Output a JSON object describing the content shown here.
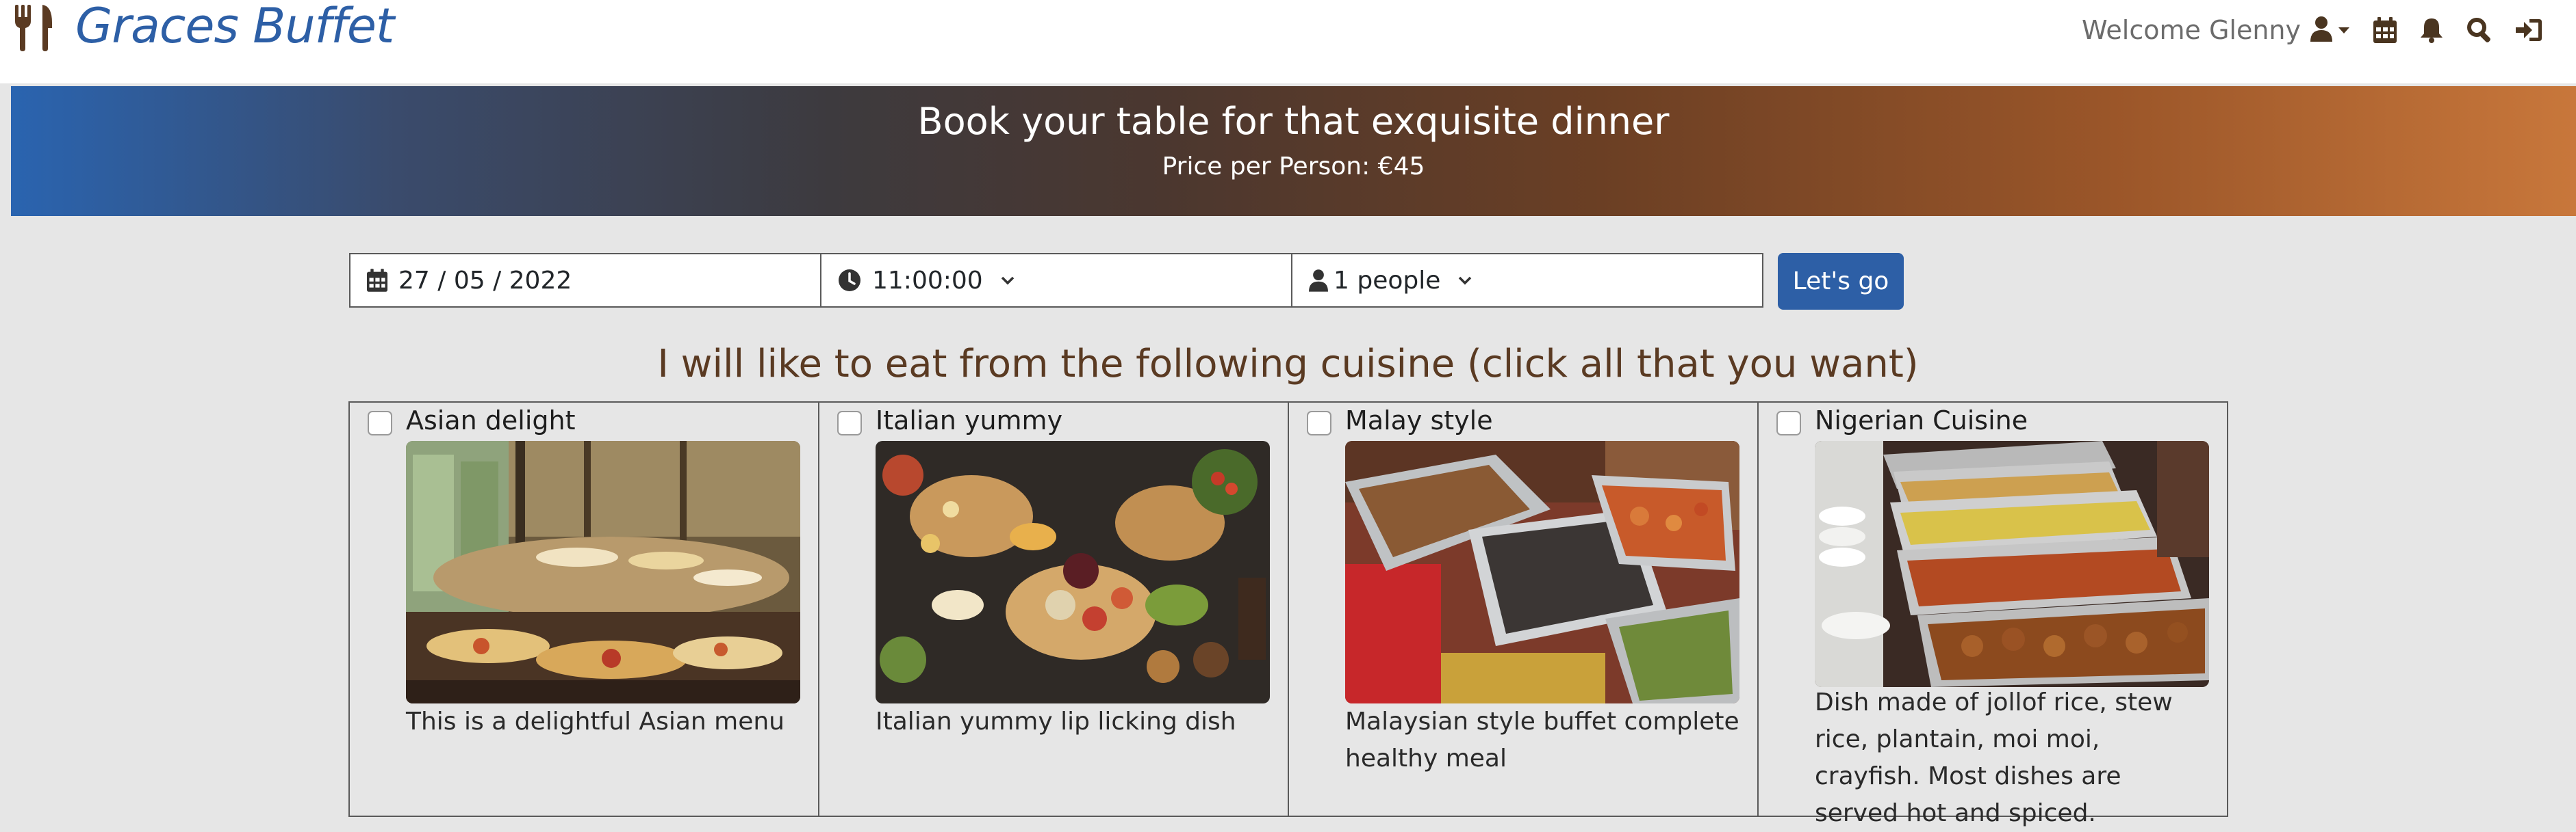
{
  "navbar": {
    "brand_name": "Graces Buffet",
    "brand_icon": "fork-knife-icon",
    "welcome_text": "Welcome Glenny",
    "icons": [
      "user-icon",
      "caret-down-icon",
      "calendar-icon",
      "bell-icon",
      "search-icon",
      "sign-out-icon"
    ]
  },
  "banner": {
    "title": "Book your table for that exquisite dinner",
    "price": "Price per Person: €45"
  },
  "booking_form": {
    "date_value": "27 / 05 / 2022",
    "time_value": "11:00:00",
    "people_value": "1 people",
    "submit_label": "Let's go"
  },
  "cuisine_section": {
    "heading": "I will like to eat from the following cuisine (click all that you want)",
    "items": [
      {
        "name": "Asian delight",
        "description": "This is a delightful Asian menu",
        "checked": false
      },
      {
        "name": "Italian yummy",
        "description": "Italian yummy lip licking dish",
        "checked": false
      },
      {
        "name": "Malay style",
        "description": "Malaysian style buffet complete healthy meal",
        "checked": false
      },
      {
        "name": "Nigerian Cuisine",
        "description": "Dish made of jollof rice, stew rice, plantain, moi moi, crayfish. Most dishes are served hot and spiced.",
        "checked": false
      }
    ]
  },
  "colors": {
    "brand": "#2d5fa6",
    "nav_icon": "#4a3520",
    "heading": "#5a3a22",
    "banner_start": "#2a64b0",
    "banner_end": "#c8773b"
  }
}
